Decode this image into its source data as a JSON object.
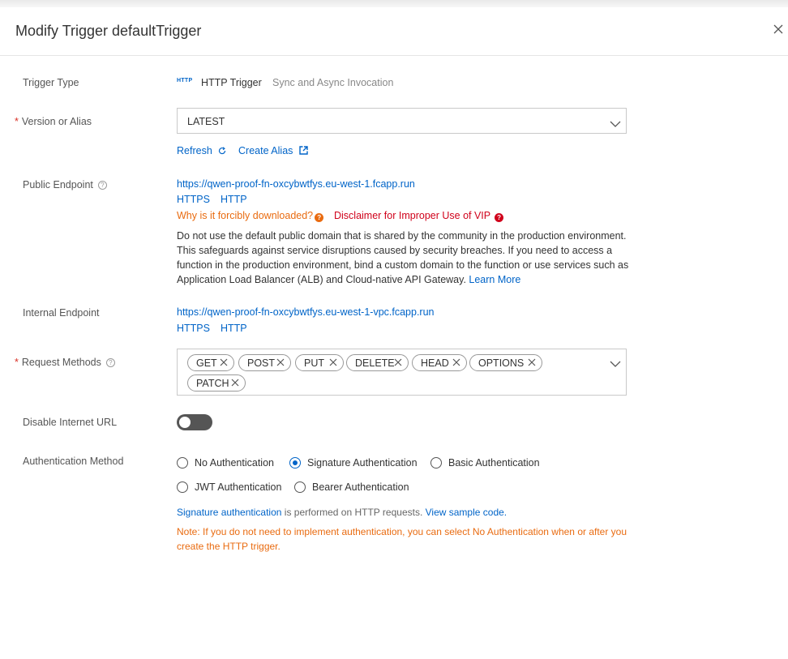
{
  "dialog": {
    "title": "Modify Trigger defaultTrigger"
  },
  "labels": {
    "trigger_type": "Trigger Type",
    "version_or_alias": "Version or Alias",
    "public_endpoint": "Public Endpoint",
    "internal_endpoint": "Internal Endpoint",
    "request_methods": "Request Methods",
    "disable_internet_url": "Disable Internet URL",
    "authentication_method": "Authentication Method",
    "required_mark": "*"
  },
  "trigger_type": {
    "icon_text": "HTTP",
    "name": "HTTP Trigger",
    "mode": "Sync and Async Invocation"
  },
  "version_select": {
    "value": "LATEST",
    "refresh_label": "Refresh",
    "create_alias_label": "Create Alias"
  },
  "public_endpoint": {
    "url": "https://qwen-proof-fn-oxcybwtfys.eu-west-1.fcapp.run",
    "https_label": "HTTPS",
    "http_label": "HTTP",
    "why_download": "Why is it forcibly downloaded?",
    "disclaimer": "Disclaimer for Improper Use of VIP",
    "warning_text": "Do not use the default public domain that is shared by the community in the production environment. This safeguards against service disruptions caused by security breaches. If you need to access a function in the production environment, bind a custom domain to the function or use services such as Application Load Balancer (ALB) and Cloud-native API Gateway.",
    "learn_more": "Learn More"
  },
  "internal_endpoint": {
    "url": "https://qwen-proof-fn-oxcybwtfys.eu-west-1-vpc.fcapp.run",
    "https_label": "HTTPS",
    "http_label": "HTTP"
  },
  "request_methods": [
    "GET",
    "POST",
    "PUT",
    "DELETE",
    "HEAD",
    "OPTIONS",
    "PATCH"
  ],
  "disable_internet_url": {
    "enabled": false
  },
  "authentication": {
    "options": [
      "No Authentication",
      "Signature Authentication",
      "Basic Authentication",
      "JWT Authentication",
      "Bearer Authentication"
    ],
    "selected": "Signature Authentication",
    "info_link": "Signature authentication",
    "info_text": " is performed on HTTP requests. ",
    "sample_code_link": "View sample code.",
    "note": "Note: If you do not need to implement authentication, you can select No Authentication when or after you create the HTTP trigger."
  },
  "colors": {
    "link": "#0064c8",
    "warning": "#e96b10",
    "danger": "#d0021b",
    "toggle_off": "#555555"
  }
}
